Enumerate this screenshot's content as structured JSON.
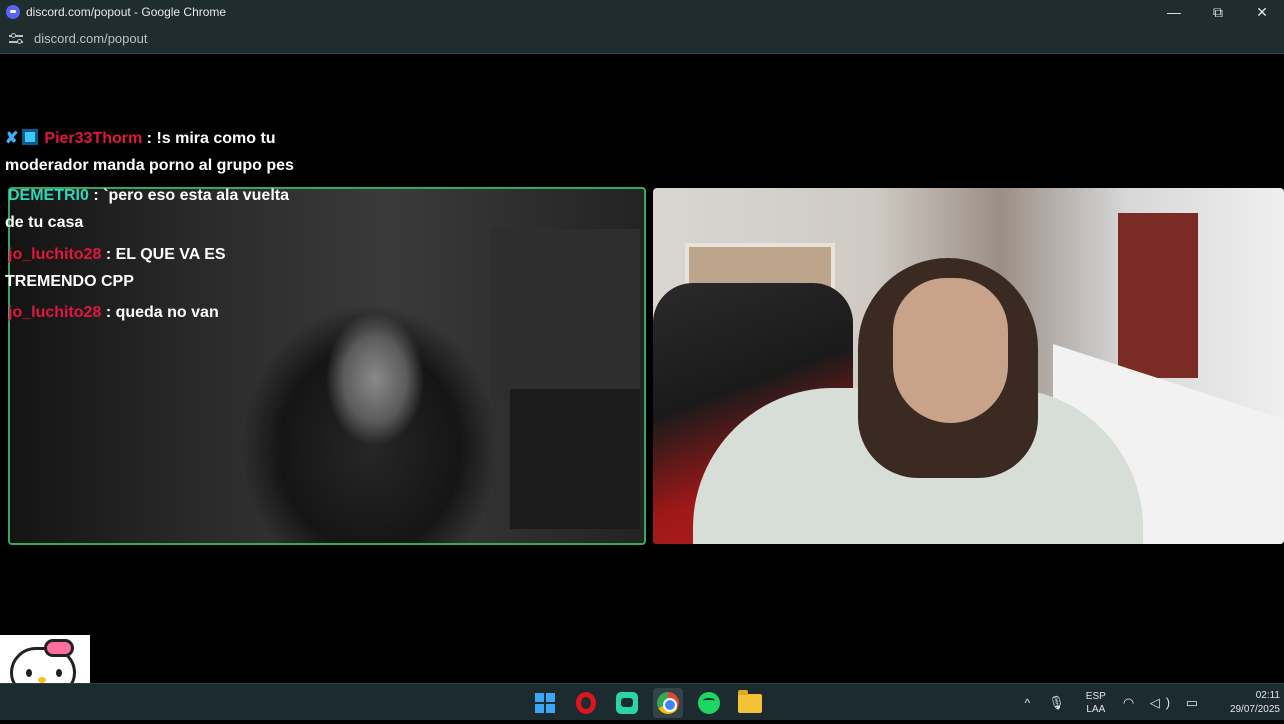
{
  "window": {
    "title": "discord.com/popout - Google Chrome",
    "controls": {
      "minimize": "—",
      "restore": "⧉",
      "close": "✕"
    }
  },
  "address_bar": {
    "url": "discord.com/popout",
    "icon": "site-settings-icon"
  },
  "chat": {
    "messages": [
      {
        "username": "Pier33Thorm",
        "text_line1": ": !s mira como tu",
        "text_line2": "moderador manda porno al grupo pes",
        "name_color": "#e0163e"
      },
      {
        "username": "DEMETRI0",
        "text_line1": ": `pero eso esta ala vuelta",
        "text_line2": "de tu casa",
        "name_color": "#2fd6b7"
      },
      {
        "username": "jo_luchito28",
        "text_line1": ": EL QUE VA ES",
        "text_line2": "TREMENDO CPP",
        "name_color": "#e0163e"
      },
      {
        "username": "jo_luchito28",
        "text_line1": ": queda no van",
        "text_line2": "",
        "name_color": "#e0163e"
      }
    ]
  },
  "video_tiles": [
    {
      "name": "left-participant",
      "speaking": true,
      "border_color": "#3ba55d"
    },
    {
      "name": "right-participant",
      "speaking": false
    }
  ],
  "taskbar": {
    "apps": [
      "windows-start-icon",
      "opera-icon",
      "chat-app-icon",
      "chrome-icon",
      "spotify-icon",
      "file-explorer-icon"
    ],
    "tray": {
      "chevron": "^",
      "mic": "🎙",
      "lang_line1": "ESP",
      "lang_line2": "LAA",
      "system_icons": "◠ ◁) ▭",
      "time": "02:11",
      "date": "29/07/2025"
    }
  }
}
